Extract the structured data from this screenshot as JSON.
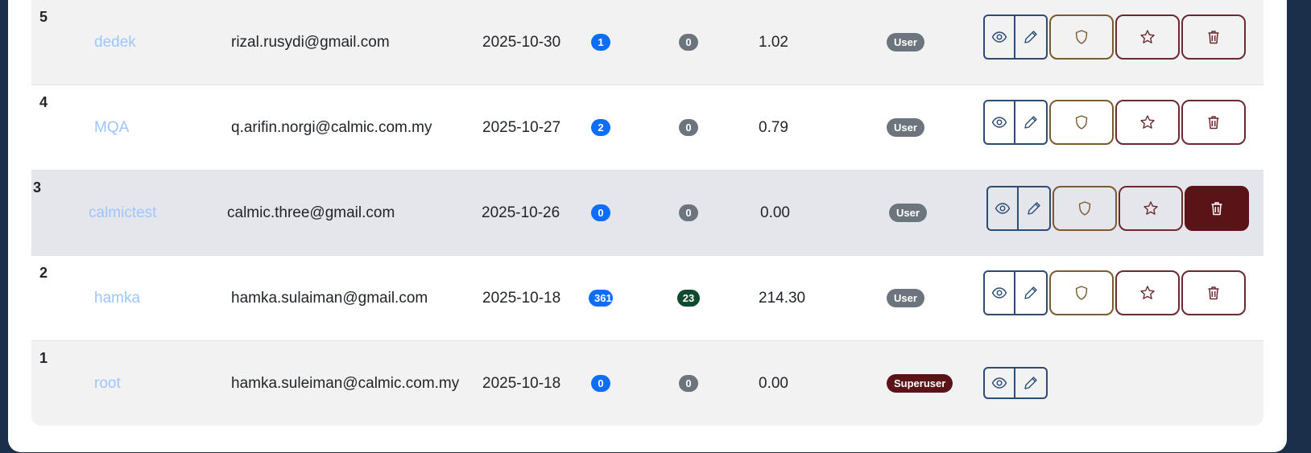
{
  "rows": [
    {
      "id": "5",
      "name": "dedek",
      "email": "rizal.rusydi@gmail.com",
      "date": "2025-10-30",
      "count1": "1",
      "count2": "0",
      "value": "1.02",
      "role": "User"
    },
    {
      "id": "4",
      "name": "MQA",
      "email": "q.arifin.norgi@calmic.com.my",
      "date": "2025-10-27",
      "count1": "2",
      "count2": "0",
      "value": "0.79",
      "role": "User"
    },
    {
      "id": "3",
      "name": "calmictest",
      "email": "calmic.three@gmail.com",
      "date": "2025-10-26",
      "count1": "0",
      "count2": "0",
      "value": "0.00",
      "role": "User"
    },
    {
      "id": "2",
      "name": "hamka",
      "email": "hamka.sulaiman@gmail.com",
      "date": "2025-10-18",
      "count1": "361",
      "count2": "23",
      "value": "214.30",
      "role": "User"
    },
    {
      "id": "1",
      "name": "root",
      "email": "hamka.suleiman@calmic.com.my",
      "date": "2025-10-18",
      "count1": "0",
      "count2": "0",
      "value": "0.00",
      "role": "Superuser"
    }
  ],
  "icons": {
    "view": "eye-icon",
    "edit": "pencil-icon",
    "permissions": "shield-icon",
    "favorite": "star-icon",
    "delete": "trash-icon"
  },
  "colors": {
    "primary": "#0d6efd",
    "secondary": "#6c757d",
    "success": "#0f4a2e",
    "danger": "#5a1316",
    "link_muted": "#9ec5fe",
    "page_bg": "#1b2f4a"
  }
}
